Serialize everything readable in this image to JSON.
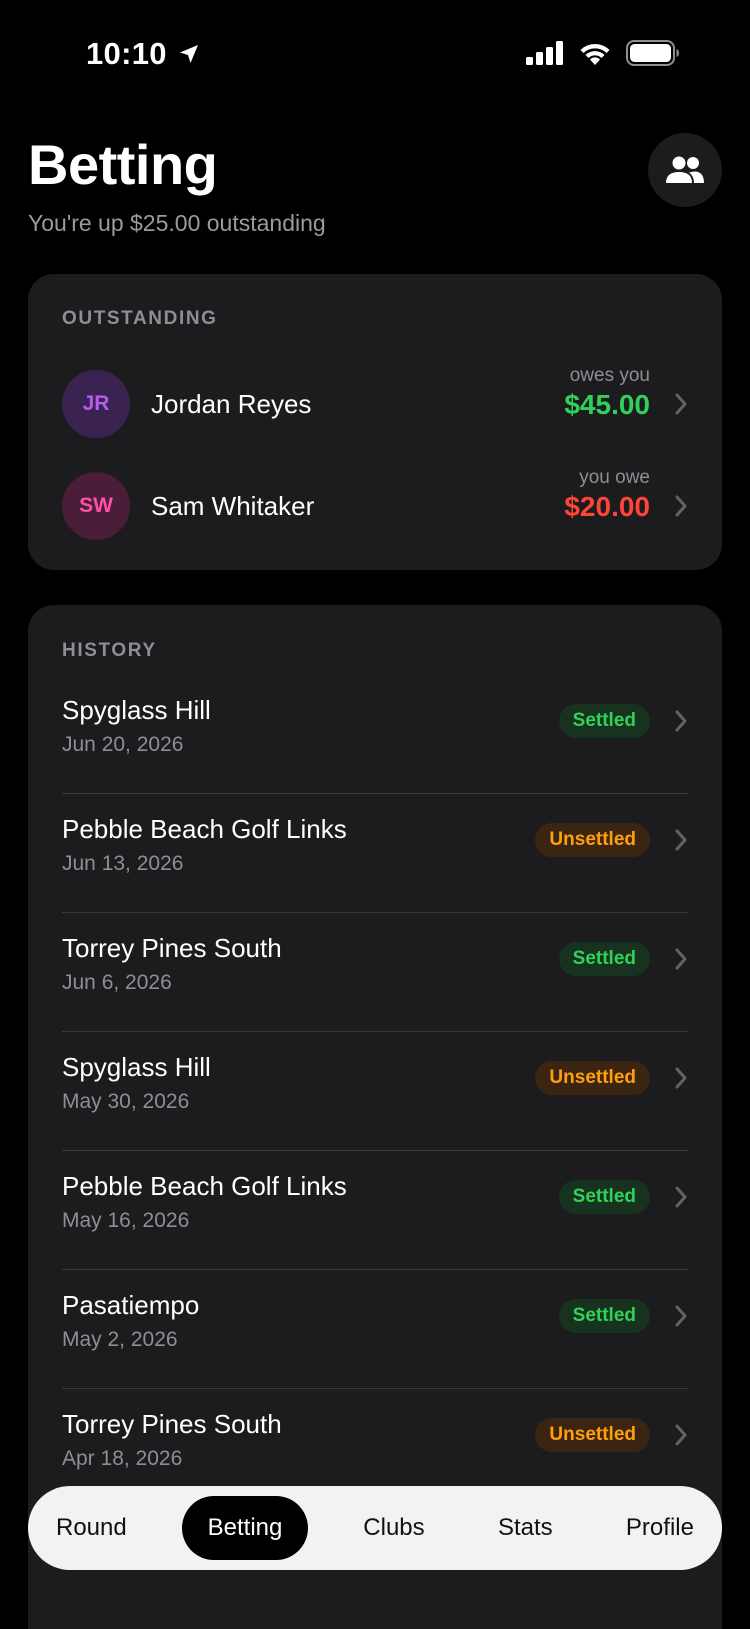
{
  "status_bar": {
    "time": "10:10"
  },
  "header": {
    "title": "Betting",
    "subtitle": "You're up $25.00 outstanding"
  },
  "outstanding": {
    "label": "OUTSTANDING",
    "items": [
      {
        "initials": "JR",
        "name": "Jordan Reyes",
        "caption": "owes you",
        "amount": "$45.00",
        "avatar_bg": "#3a2350",
        "avatar_fg": "#b35cf0",
        "amount_color": "#30d158"
      },
      {
        "initials": "SW",
        "name": "Sam Whitaker",
        "caption": "you owe",
        "amount": "$20.00",
        "avatar_bg": "#4a1d38",
        "avatar_fg": "#ff4fa8",
        "amount_color": "#ff453a"
      }
    ]
  },
  "history": {
    "label": "HISTORY",
    "items": [
      {
        "course": "Spyglass Hill",
        "date": "Jun 20, 2026",
        "status": "Settled"
      },
      {
        "course": "Pebble Beach Golf Links",
        "date": "Jun 13, 2026",
        "status": "Unsettled"
      },
      {
        "course": "Torrey Pines South",
        "date": "Jun 6, 2026",
        "status": "Settled"
      },
      {
        "course": "Spyglass Hill",
        "date": "May 30, 2026",
        "status": "Unsettled"
      },
      {
        "course": "Pebble Beach Golf Links",
        "date": "May 16, 2026",
        "status": "Settled"
      },
      {
        "course": "Pasatiempo",
        "date": "May 2, 2026",
        "status": "Settled"
      },
      {
        "course": "Torrey Pines South",
        "date": "Apr 18, 2026",
        "status": "Unsettled"
      }
    ]
  },
  "tabs": [
    {
      "label": "Round",
      "active": false
    },
    {
      "label": "Betting",
      "active": true
    },
    {
      "label": "Clubs",
      "active": false
    },
    {
      "label": "Stats",
      "active": false
    },
    {
      "label": "Profile",
      "active": false
    }
  ],
  "icons": {
    "location": "location-arrow-icon",
    "signal": "cellular-signal-icon",
    "wifi": "wifi-icon",
    "battery": "battery-icon",
    "people": "people-icon",
    "chevron": "chevron-right-icon"
  }
}
